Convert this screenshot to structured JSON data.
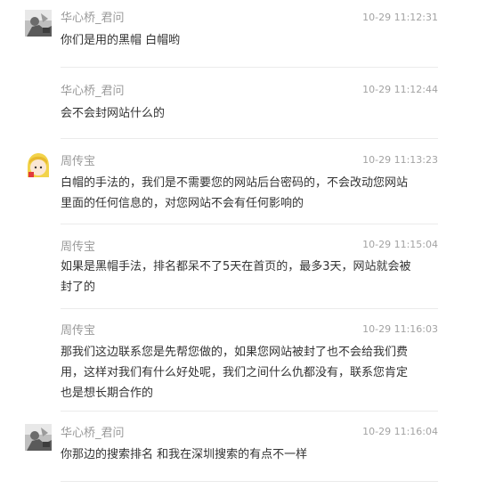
{
  "messages": [
    {
      "sender": "华心桥_君问",
      "time": "10-29 11:12:31",
      "text": "你们是用的黑帽 白帽哟",
      "avatar": "bw-photo-avatar"
    },
    {
      "sender": "华心桥_君问",
      "time": "10-29 11:12:44",
      "text": "会不会封网站什么的",
      "avatar": ""
    },
    {
      "sender": "周传宝",
      "time": "10-29 11:13:23",
      "text": "白帽的手法的，我们是不需要您的网站后台密码的，不会改动您网站里面的任何信息的，对您网站不会有任何影响的",
      "avatar": "cartoon-girl-avatar"
    },
    {
      "sender": "周传宝",
      "time": "10-29 11:15:04",
      "text": "如果是黑帽手法，排名都呆不了5天在首页的，最多3天，网站就会被封了的",
      "avatar": ""
    },
    {
      "sender": "周传宝",
      "time": "10-29 11:16:03",
      "text": "那我们这边联系您是先帮您做的，如果您网站被封了也不会给我们费用，这样对我们有什么好处呢，我们之间什么仇都没有，联系您肯定也是想长期合作的",
      "avatar": ""
    },
    {
      "sender": "华心桥_君问",
      "time": "10-29 11:16:04",
      "text": "你那边的搜索排名 和我在深圳搜索的有点不一样",
      "avatar": "bw-photo-avatar"
    }
  ]
}
